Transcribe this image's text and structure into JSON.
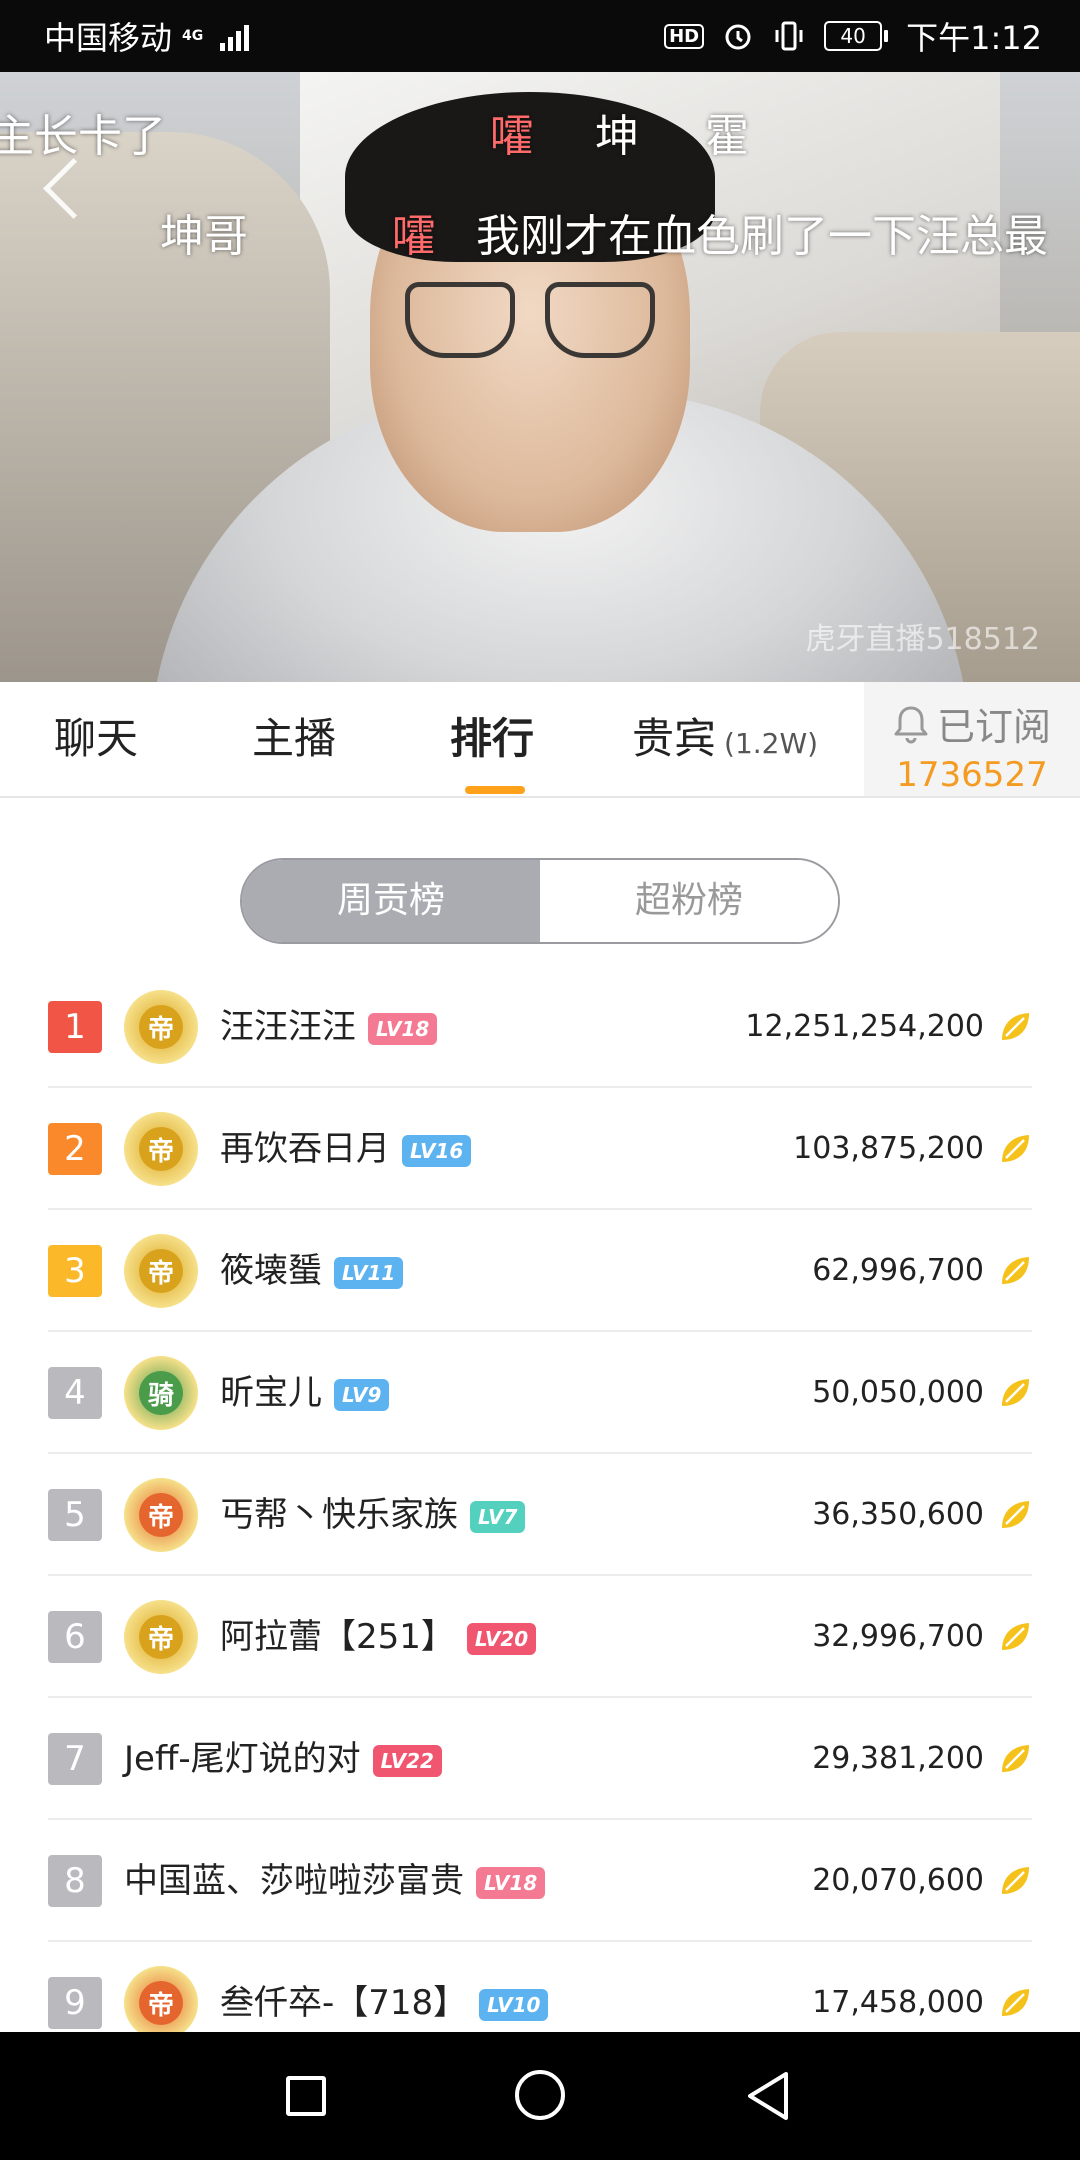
{
  "status_bar": {
    "carrier": "中国移动",
    "network": "4G",
    "hd": "HD",
    "battery": "40",
    "time": "下午1:12"
  },
  "video": {
    "danmaku": [
      {
        "text": "主长卡了",
        "color": "#ffffff"
      },
      {
        "text": "嚯",
        "color": "#ff6b6b"
      },
      {
        "text": "坤",
        "color": "#ffffff"
      },
      {
        "text": "霍",
        "color": "#ffffff"
      },
      {
        "text": "坤哥",
        "color": "#ffffff"
      },
      {
        "text": "嚯",
        "color": "#ff6b6b"
      },
      {
        "text": "我刚才在血色刷了一下汪总最",
        "color": "#ffffff"
      }
    ],
    "watermark": "虎牙直播518512"
  },
  "tabs": [
    {
      "label": "聊天"
    },
    {
      "label": "主播"
    },
    {
      "label": "排行"
    },
    {
      "label": "贵宾",
      "count": "(1.2W)"
    }
  ],
  "subscribe": {
    "label": "已订阅",
    "count": "1736527",
    "icon": "bell-icon"
  },
  "segments": {
    "selected": "周贡榜",
    "other": "超粉榜"
  },
  "ranking": [
    {
      "rank": "1",
      "rank_color": "#f05545",
      "badge": "帝",
      "badge_color": "#d9a21c",
      "name": "汪汪汪汪",
      "level": "LV18",
      "level_color": "#f47a93",
      "score": "12,251,254,200"
    },
    {
      "rank": "2",
      "rank_color": "#f9892a",
      "badge": "帝",
      "badge_color": "#d9a21c",
      "name": "再饮吞日月",
      "level": "LV16",
      "level_color": "#5db3f0",
      "score": "103,875,200"
    },
    {
      "rank": "3",
      "rank_color": "#fbb829",
      "badge": "帝",
      "badge_color": "#d9a21c",
      "name": "筱壊蜑",
      "level": "LV11",
      "level_color": "#5db3f0",
      "score": "62,996,700"
    },
    {
      "rank": "4",
      "rank_color": "#b9b9be",
      "badge": "骑",
      "badge_color": "#4a9b4a",
      "name": "昕宝儿",
      "level": "LV9",
      "level_color": "#5db3f0",
      "score": "50,050,000"
    },
    {
      "rank": "5",
      "rank_color": "#b9b9be",
      "badge": "帝",
      "badge_color": "#e4662e",
      "name": "丐帮丶快乐家族",
      "level": "LV7",
      "level_color": "#54d1be",
      "score": "36,350,600"
    },
    {
      "rank": "6",
      "rank_color": "#b9b9be",
      "badge": "帝",
      "badge_color": "#d9a21c",
      "name": "阿拉蕾【251】",
      "level": "LV20",
      "level_color": "#f0566f",
      "score": "32,996,700"
    },
    {
      "rank": "7",
      "rank_color": "#b9b9be",
      "badge": "",
      "badge_color": "",
      "name": "Jeff-尾灯说的对",
      "level": "LV22",
      "level_color": "#f0566f",
      "score": "29,381,200"
    },
    {
      "rank": "8",
      "rank_color": "#b9b9be",
      "badge": "",
      "badge_color": "",
      "name": "中国蓝、莎啦啦莎富贵",
      "level": "LV18",
      "level_color": "#f47a93",
      "score": "20,070,600"
    },
    {
      "rank": "9",
      "rank_color": "#b9b9be",
      "badge": "帝",
      "badge_color": "#e4662e",
      "name": "叁仟卒-【718】",
      "level": "LV10",
      "level_color": "#5db3f0",
      "score": "17,458,000"
    }
  ],
  "colors": {
    "accent": "#ffa21b",
    "subscribe_count": "#f39b22",
    "coin": "#f5c21b"
  }
}
